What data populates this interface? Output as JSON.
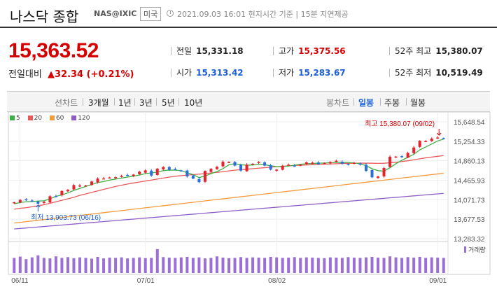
{
  "header": {
    "title": "나스닥 종합",
    "ticker": "NAS@IXIC",
    "market": "미국",
    "timestamp": "2021.09.03 16:01 현지시간 기준 | 15분 지연제공"
  },
  "quote": {
    "price": "15,363.52",
    "change_label": "전일대비",
    "change_value": "▲32.34 (+0.21%)",
    "stats": [
      {
        "label": "전일",
        "value": "15,331.18",
        "color": "dark"
      },
      {
        "label": "고가",
        "value": "15,375.56",
        "color": "red"
      },
      {
        "label": "52주 최고",
        "value": "15,380.07",
        "color": "dark"
      },
      {
        "label": "시가",
        "value": "15,313.42",
        "color": "blue"
      },
      {
        "label": "저가",
        "value": "15,283.67",
        "color": "blue"
      },
      {
        "label": "52주 최저",
        "value": "10,519.49",
        "color": "dark"
      }
    ]
  },
  "tabs": {
    "line_head": "선차트",
    "line": [
      "3개월",
      "1년",
      "3년",
      "5년",
      "10년"
    ],
    "candle_head": "봉차트",
    "candle": [
      "일봉",
      "주봉",
      "월봉"
    ],
    "active": "일봉"
  },
  "legend": [
    {
      "label": "5",
      "color": "#3cb043"
    },
    {
      "label": "20",
      "color": "#e8585a"
    },
    {
      "label": "60",
      "color": "#f39a3d"
    },
    {
      "label": "120",
      "color": "#8e5dc8"
    }
  ],
  "colors": {
    "up": "#e8212c",
    "down": "#2a6fdb",
    "volume": "#9a6fd6"
  },
  "chart_data": {
    "type": "candlestick",
    "y_ticks": [
      "15,648.54",
      "15,254.33",
      "14,860.13",
      "14,465.93",
      "14,071.73",
      "13,677.53",
      "13,283.32"
    ],
    "ylim": [
      13283.32,
      15648.54
    ],
    "x_labels": [
      "06/11",
      "07/01",
      "08/02",
      "09/01"
    ],
    "annotation_high": "최고 15,380.07 (09/02)",
    "annotation_low": "최저 13,903.73 (06/16)",
    "volume_label": "거래량",
    "closes": [
      14020,
      14069,
      14072,
      14040,
      13990,
      14030,
      14142,
      14141,
      14250,
      14272,
      14369,
      14361,
      14360,
      14440,
      14500,
      14503,
      14522,
      14528,
      14554,
      14563,
      14580,
      14639,
      14665,
      14560,
      14701,
      14733,
      14678,
      14676,
      14659,
      14542,
      14498,
      14427,
      14655,
      14696,
      14736,
      14841,
      14837,
      14762,
      14660,
      14781,
      14800,
      14836,
      14761,
      14680,
      14681,
      14761,
      14780,
      14761,
      14780,
      14828,
      14822,
      14788,
      14816,
      14835,
      14860,
      14800,
      14787,
      14820,
      14780,
      14656,
      14525,
      14541,
      14714,
      14942,
      14945,
      14943,
      15019,
      15129,
      15265,
      15259,
      15309,
      15331,
      15309
    ],
    "ma5": [
      13990,
      14015,
      14030,
      14035,
      14045,
      14050,
      14090,
      14140,
      14170,
      14210,
      14260,
      14300,
      14340,
      14380,
      14420,
      14440,
      14470,
      14490,
      14510,
      14530,
      14550,
      14570,
      14600,
      14615,
      14630,
      14660,
      14672,
      14670,
      14660,
      14620,
      14580,
      14520,
      14550,
      14600,
      14640,
      14700,
      14780,
      14800,
      14780,
      14770,
      14775,
      14790,
      14780,
      14760,
      14740,
      14740,
      14755,
      14770,
      14790,
      14800,
      14805,
      14810,
      14815,
      14820,
      14828,
      14830,
      14825,
      14815,
      14800,
      14760,
      14700,
      14660,
      14650,
      14720,
      14800,
      14870,
      14930,
      14990,
      15080,
      15140,
      15200,
      15260,
      15300
    ],
    "ma20": [
      13880,
      13900,
      13910,
      13930,
      13950,
      13970,
      14000,
      14030,
      14060,
      14090,
      14120,
      14160,
      14190,
      14220,
      14250,
      14280,
      14310,
      14340,
      14365,
      14390,
      14410,
      14430,
      14450,
      14470,
      14490,
      14510,
      14530,
      14545,
      14560,
      14570,
      14580,
      14590,
      14600,
      14615,
      14625,
      14640,
      14655,
      14670,
      14680,
      14690,
      14700,
      14710,
      14720,
      14730,
      14740,
      14748,
      14756,
      14764,
      14770,
      14775,
      14780,
      14785,
      14790,
      14795,
      14800,
      14805,
      14808,
      14810,
      14812,
      14812,
      14810,
      14808,
      14810,
      14820,
      14830,
      14845,
      14860,
      14880,
      14900,
      14920,
      14935,
      14950,
      14965
    ],
    "ma60": [
      13600,
      13614,
      13628,
      13642,
      13656,
      13670,
      13684,
      13698,
      13712,
      13726,
      13740,
      13754,
      13768,
      13782,
      13796,
      13810,
      13824,
      13838,
      13852,
      13866,
      13880,
      13894,
      13908,
      13922,
      13936,
      13950,
      13964,
      13978,
      13992,
      14006,
      14020,
      14034,
      14048,
      14062,
      14076,
      14090,
      14104,
      14118,
      14132,
      14146,
      14160,
      14174,
      14188,
      14202,
      14216,
      14230,
      14244,
      14258,
      14272,
      14286,
      14300,
      14314,
      14328,
      14342,
      14356,
      14370,
      14384,
      14398,
      14412,
      14426,
      14440,
      14454,
      14468,
      14482,
      14496,
      14510,
      14524,
      14538,
      14552,
      14566,
      14580,
      14594,
      14608
    ],
    "ma120": [
      13480,
      13490,
      13500,
      13510,
      13520,
      13530,
      13540,
      13550,
      13560,
      13570,
      13580,
      13590,
      13600,
      13610,
      13620,
      13630,
      13640,
      13650,
      13660,
      13670,
      13680,
      13690,
      13700,
      13710,
      13720,
      13730,
      13740,
      13750,
      13760,
      13770,
      13780,
      13790,
      13800,
      13810,
      13820,
      13830,
      13840,
      13850,
      13860,
      13870,
      13880,
      13890,
      13900,
      13910,
      13920,
      13930,
      13940,
      13950,
      13960,
      13970,
      13980,
      13990,
      14000,
      14010,
      14020,
      14030,
      14040,
      14050,
      14060,
      14070,
      14080,
      14090,
      14100,
      14110,
      14120,
      14130,
      14140,
      14150,
      14160,
      14170,
      14180,
      14190,
      14200
    ],
    "volume": [
      0.6,
      0.65,
      0.55,
      0.62,
      0.7,
      0.6,
      0.58,
      0.66,
      0.6,
      0.63,
      0.59,
      0.62,
      0.6,
      0.57,
      0.64,
      0.58,
      0.61,
      0.6,
      0.62,
      0.58,
      0.6,
      0.62,
      0.59,
      0.6,
      0.95,
      0.63,
      0.61,
      0.6,
      0.62,
      0.64,
      0.6,
      0.62,
      0.58,
      0.6,
      0.66,
      0.61,
      0.59,
      0.6,
      0.63,
      0.6,
      0.62,
      0.61,
      0.6,
      0.64,
      0.62,
      0.6,
      0.61,
      0.63,
      0.6,
      0.62,
      0.61,
      0.6,
      0.59,
      0.62,
      0.61,
      0.6,
      0.63,
      0.61,
      0.6,
      0.62,
      0.64,
      0.61,
      0.6,
      0.66,
      0.62,
      0.6,
      0.63,
      0.61,
      0.64,
      0.6,
      0.62,
      0.61,
      0.6
    ]
  }
}
